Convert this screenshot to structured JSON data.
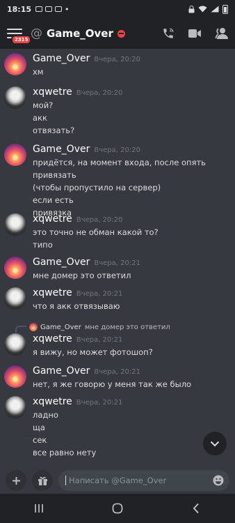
{
  "status_bar": {
    "time": "18:15",
    "dot": "•"
  },
  "header": {
    "at_symbol": "@",
    "channel_name": "Game_Over",
    "mention_badge": "2315"
  },
  "messages": [
    {
      "author": "Game_Over",
      "timestamp": "Вчера, 20:20",
      "avatar": "sunset",
      "lines": [
        "хм"
      ]
    },
    {
      "author": "xqwetre",
      "timestamp": "Вчера, 20:20",
      "avatar": "anime",
      "lines": [
        "мой?",
        "акк",
        "отвязать?"
      ]
    },
    {
      "author": "Game_Over",
      "timestamp": "Вчера, 20:20",
      "avatar": "sunset",
      "lines": [
        "придётся, на момент входа, после опять привязать",
        "(чтобы пропустило на сервер)",
        "если есть",
        "привязка"
      ]
    },
    {
      "author": "xqwetre",
      "timestamp": "Вчера, 20:20",
      "avatar": "anime",
      "lines": [
        "это точно не обман какой то?",
        "типо"
      ]
    },
    {
      "author": "Game_Over",
      "timestamp": "Вчера, 20:21",
      "avatar": "sunset",
      "lines": [
        "мне домер это ответил"
      ]
    },
    {
      "author": "xqwetre",
      "timestamp": "Вчера, 20:21",
      "avatar": "anime",
      "lines": [
        "что я акк отвязываю"
      ]
    },
    {
      "author": "xqwetre",
      "timestamp": "Вчера, 20:21",
      "avatar": "anime",
      "lines": [
        "я вижу, но может фотошоп?"
      ]
    },
    {
      "author": "Game_Over",
      "timestamp": "Вчера, 20:21",
      "avatar": "sunset",
      "lines": [
        "нет, я же говорю у меня так же было"
      ]
    },
    {
      "author": "xqwetre",
      "timestamp": "Вчера, 20:21",
      "avatar": "anime",
      "lines": [
        "ладно",
        "ща",
        "сек",
        "все равно нету"
      ]
    }
  ],
  "reply": {
    "author": "Game_Over",
    "text": "мне домер это ответил"
  },
  "composer": {
    "placeholder": "Написать @Game_Over"
  },
  "colors": {
    "background": "#36393f",
    "bars": "#202225",
    "dnd": "#ed4245",
    "input": "#40444b"
  }
}
